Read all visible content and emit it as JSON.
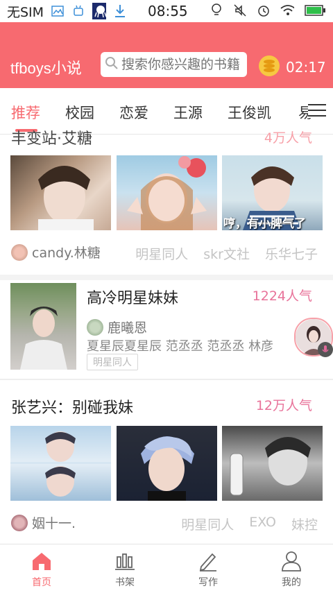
{
  "status_bar": {
    "carrier": "无SIM",
    "time": "08:55",
    "icons": [
      "gallery-icon",
      "android-icon",
      "octopus-app-icon",
      "download-icon",
      "bulb-icon",
      "mute-icon",
      "alarm-icon",
      "wifi-icon",
      "battery-icon"
    ]
  },
  "header": {
    "app_name": "tfboys小说",
    "search_placeholder": "搜索你感兴趣的书籍",
    "timer": "02:17"
  },
  "tabs": [
    "推荐",
    "校园",
    "恋爱",
    "王源",
    "王俊凯",
    "易"
  ],
  "sections": [
    {
      "title": "丰变站·艾糖",
      "popularity": "4万人气",
      "author": "candy.林糖",
      "tags": [
        "明星同人",
        "skr文社",
        "乐华七子"
      ],
      "image_captions": [
        "",
        "",
        "哼，有小脾气了"
      ]
    },
    {
      "title": "高冷明星妹妹",
      "popularity": "1224人气",
      "author": "鹿曦恩",
      "characters": "夏星辰夏星辰 范丞丞 范丞丞 林彦",
      "category": "明星同人"
    },
    {
      "title": "张艺兴：别碰我妹",
      "popularity": "12万人气",
      "author": "姻十一.",
      "tags": [
        "明星同人",
        "EXO",
        "妹控"
      ]
    }
  ],
  "bottom_nav": [
    {
      "label": "首页",
      "icon": "home-icon",
      "active": true
    },
    {
      "label": "书架",
      "icon": "bookshelf-icon",
      "active": false
    },
    {
      "label": "写作",
      "icon": "pen-icon",
      "active": false
    },
    {
      "label": "我的",
      "icon": "profile-icon",
      "active": false
    }
  ],
  "colors": {
    "accent": "#f76a70",
    "tag_grey": "#c4c4c4",
    "pop_pink": "#f76a70"
  }
}
